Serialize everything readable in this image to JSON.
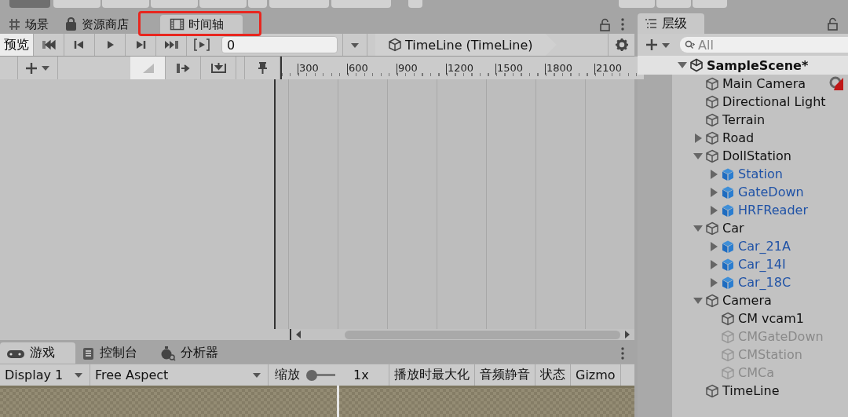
{
  "timeline_panel": {
    "tabs": [
      {
        "label": "场景",
        "selected": false,
        "highlighted": false
      },
      {
        "label": "资源商店",
        "selected": false,
        "highlighted": false
      },
      {
        "label": "时间轴",
        "selected": true,
        "highlighted": true
      }
    ],
    "preview": {
      "label": "预览",
      "on": true
    },
    "frame": "0",
    "breadcrumb": "TimeLine (TimeLine)",
    "ruler": [
      "300",
      "600",
      "900",
      "1200",
      "1500",
      "1800",
      "2100"
    ]
  },
  "game_panel": {
    "tabs": [
      {
        "label": "游戏",
        "selected": true
      },
      {
        "label": "控制台",
        "selected": false
      },
      {
        "label": "分析器",
        "selected": false
      }
    ],
    "display": "Display 1",
    "aspect": "Free Aspect",
    "scale_label": "缩放",
    "scale": {
      "level": 0
    },
    "scale_value": "1x",
    "toggles": [
      {
        "label": "播放时最大化",
        "on": false
      },
      {
        "label": "音频静音",
        "on": false
      },
      {
        "label": "状态",
        "on": false
      },
      {
        "label": "Gizmo",
        "on": false
      }
    ]
  },
  "hierarchy": {
    "tab": "层级",
    "search_placeholder": "All",
    "scene": {
      "name": "SampleScene*",
      "expanded": true,
      "children": [
        {
          "name": "Main Camera",
          "kind": "object",
          "disabled": false,
          "gizmo": true
        },
        {
          "name": "Directional Light",
          "kind": "object",
          "disabled": false,
          "gizmo": false
        },
        {
          "name": "Terrain",
          "kind": "object",
          "disabled": false,
          "gizmo": false
        },
        {
          "name": "Road",
          "kind": "object",
          "expanded": false,
          "disabled": false,
          "gizmo": false
        },
        {
          "name": "DollStation",
          "kind": "object",
          "expanded": true,
          "disabled": false,
          "gizmo": false,
          "children": [
            {
              "name": "Station",
              "kind": "prefab",
              "expanded": false,
              "disabled": false,
              "gizmo": false
            },
            {
              "name": "GateDown",
              "kind": "prefab",
              "expanded": false,
              "disabled": false,
              "gizmo": false
            },
            {
              "name": "HRFReader",
              "kind": "prefab",
              "expanded": false,
              "disabled": false,
              "gizmo": false
            }
          ]
        },
        {
          "name": "Car",
          "kind": "object",
          "expanded": true,
          "disabled": false,
          "gizmo": false,
          "children": [
            {
              "name": "Car_21A",
              "kind": "prefab",
              "expanded": false,
              "disabled": false,
              "gizmo": false
            },
            {
              "name": "Car_14I",
              "kind": "prefab",
              "expanded": false,
              "disabled": false,
              "gizmo": false
            },
            {
              "name": "Car_18C",
              "kind": "prefab",
              "expanded": false,
              "disabled": false,
              "gizmo": false
            }
          ]
        },
        {
          "name": "Camera",
          "kind": "object",
          "expanded": true,
          "disabled": false,
          "gizmo": false,
          "children": [
            {
              "name": "CM vcam1",
              "kind": "object",
              "disabled": false,
              "gizmo": false
            },
            {
              "name": "CMGateDown",
              "kind": "object",
              "disabled": true,
              "gizmo": false
            },
            {
              "name": "CMStation",
              "kind": "object",
              "disabled": true,
              "gizmo": false
            },
            {
              "name": "CMCa",
              "kind": "object",
              "disabled": true,
              "gizmo": false
            }
          ]
        },
        {
          "name": "TimeLine",
          "kind": "object",
          "disabled": false,
          "gizmo": false
        }
      ]
    }
  }
}
